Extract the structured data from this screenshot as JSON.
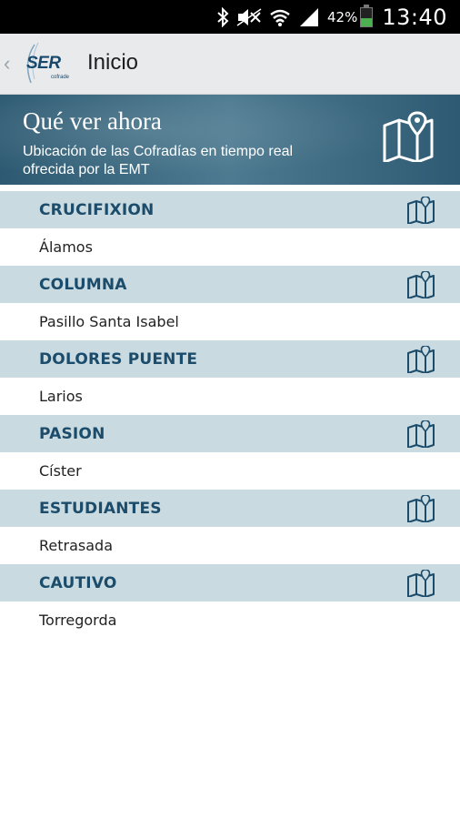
{
  "status_bar": {
    "battery_percent": "42%",
    "battery_level": 0.42,
    "time": "13:40",
    "icons": [
      "bluetooth-icon",
      "mute-icon",
      "wifi-icon",
      "signal-icon",
      "battery-icon"
    ]
  },
  "action_bar": {
    "logo_text": "SER",
    "logo_subtext": "cofrade",
    "title": "Inicio",
    "back_icon": "chevron-left-icon"
  },
  "banner": {
    "title": "Qué ver ahora",
    "subtitle": "Ubicación de las Cofradías en tiempo real ofrecida por la EMT",
    "icon": "map-icon"
  },
  "cofradias": [
    {
      "name": "CRUCIFIXION",
      "location": "Álamos"
    },
    {
      "name": "COLUMNA",
      "location": "Pasillo Santa Isabel"
    },
    {
      "name": "DOLORES PUENTE",
      "location": "Larios"
    },
    {
      "name": "PASION",
      "location": "Císter"
    },
    {
      "name": "ESTUDIANTES",
      "location": "Retrasada"
    },
    {
      "name": "CAUTIVO",
      "location": "Torregorda"
    }
  ],
  "colors": {
    "accent": "#1b4c6b",
    "header_bg": "#c9dae0",
    "banner_bg": "#3b6a82",
    "status_bar_bg": "#000000",
    "action_bar_bg": "#e8eaec"
  }
}
